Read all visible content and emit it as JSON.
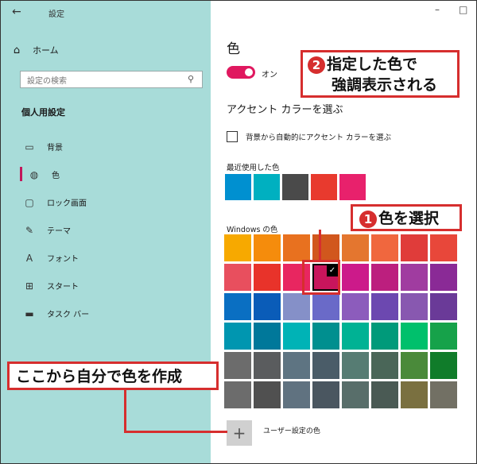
{
  "window": {
    "title": "設定",
    "minimize": "–",
    "maximize": "□"
  },
  "sidebar": {
    "home_label": "ホーム",
    "search_placeholder": "設定の検索",
    "section_title": "個人用設定",
    "items": [
      {
        "label": "背景",
        "icon": "image-icon"
      },
      {
        "label": "色",
        "icon": "palette-icon",
        "active": true
      },
      {
        "label": "ロック画面",
        "icon": "lock-screen-icon"
      },
      {
        "label": "テーマ",
        "icon": "theme-icon"
      },
      {
        "label": "フォント",
        "icon": "font-icon"
      },
      {
        "label": "スタート",
        "icon": "start-icon"
      },
      {
        "label": "タスク バー",
        "icon": "taskbar-icon"
      }
    ]
  },
  "main": {
    "page_title": "色",
    "toggle_label": "オン",
    "accent_title": "アクセント カラーを選ぶ",
    "auto_accent_label": "背景から自動的にアクセント カラーを選ぶ",
    "recent_label": "最近使用した色",
    "recent_colors": [
      "#0090d0",
      "#00b0c0",
      "#4a4a4a",
      "#e83a2e",
      "#e8216c"
    ],
    "windows_colors_label": "Windows の色",
    "windows_colors": [
      "#f7a900",
      "#f58c0c",
      "#e8711f",
      "#d1571d",
      "#e4762f",
      "#f0673e",
      "#e03c3a",
      "#e8473a",
      "#e84f5e",
      "#e8332a",
      "#e82660",
      "#c8155c",
      "#cc1a8a",
      "#bc1f7e",
      "#a03ca0",
      "#8a2a96",
      "#0a6fc2",
      "#0a5cb8",
      "#8590c8",
      "#6a6ac8",
      "#8c5cbc",
      "#6c48b0",
      "#8858b0",
      "#6a3a98",
      "#0096b0",
      "#00789a",
      "#00b3b6",
      "#008f8f",
      "#00b294",
      "#009a7a",
      "#00c06c",
      "#16a24a",
      "#6c6c6c",
      "#5a5c5e",
      "#5e7482",
      "#4a5c68",
      "#567c73",
      "#4a6658",
      "#4a8a3a",
      "#107c2a",
      "#6c6c6c",
      "#505050",
      "#607280",
      "#4a5660",
      "#586e6a",
      "#4a5a54",
      "#7a7040",
      "#727064"
    ],
    "selected_index": 11,
    "custom_color_label": "ユーザー設定の色",
    "custom_plus": "+"
  },
  "annotations": {
    "a2_num": "2",
    "a2_line1": "指定した色で",
    "a2_line2": "強調表示される",
    "a1_num": "1",
    "a1_text": "色を選択",
    "a3_text": "ここから自分で色を作成",
    "accent_color": "#d62e2e"
  }
}
